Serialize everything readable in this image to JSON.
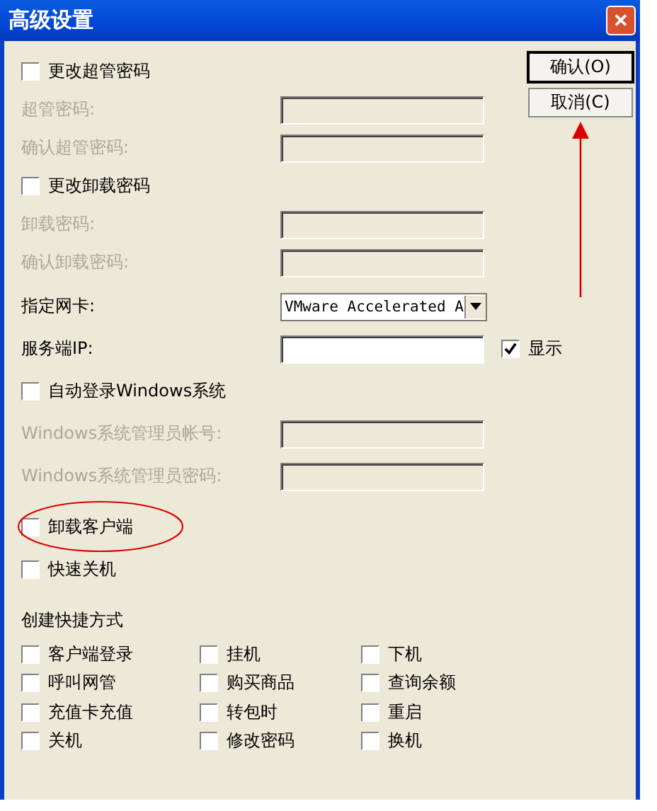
{
  "window": {
    "title": "高级设置",
    "close": "✕"
  },
  "buttons": [
    {
      "label": "确认(O)",
      "default": true
    },
    {
      "label": "取消(C)",
      "default": false
    }
  ],
  "top_rows": [
    {
      "kind": "checkbox",
      "label": "更改超管密码",
      "checked": false
    },
    {
      "kind": "field",
      "label": "超管密码:",
      "disabled": true
    },
    {
      "kind": "field",
      "label": "确认超管密码:",
      "disabled": true
    },
    {
      "kind": "checkbox",
      "label": "更改卸载密码",
      "checked": false
    },
    {
      "kind": "field",
      "label": "卸载密码:",
      "disabled": true
    },
    {
      "kind": "field",
      "label": "确认卸载密码:",
      "disabled": true
    }
  ],
  "rows": [
    {
      "kind": "select",
      "label": "指定网卡:",
      "value": "VMware Accelerated A"
    },
    {
      "kind": "field",
      "label": "服务端IP:",
      "disabled": false,
      "check": {
        "label": "显示",
        "checked": true
      }
    },
    {
      "kind": "checkbox",
      "label": "自动登录Windows系统",
      "checked": false
    },
    {
      "kind": "field",
      "label": "Windows系统管理员帐号:",
      "disabled": true
    },
    {
      "kind": "field",
      "label": "Windows系统管理员密码:",
      "disabled": true
    },
    {
      "kind": "checkbox",
      "label": "卸载客户端",
      "checked": false,
      "circled": true
    },
    {
      "kind": "checkbox",
      "label": "快速关机",
      "checked": false
    }
  ],
  "shortcuts": {
    "heading": "创建快捷方式",
    "items": [
      {
        "label": "客户端登录",
        "checked": false
      },
      {
        "label": "挂机",
        "checked": false
      },
      {
        "label": "下机",
        "checked": false
      },
      {
        "label": "呼叫网管",
        "checked": false
      },
      {
        "label": "购买商品",
        "checked": false
      },
      {
        "label": "查询余额",
        "checked": false
      },
      {
        "label": "充值卡充值",
        "checked": false
      },
      {
        "label": "转包时",
        "checked": false
      },
      {
        "label": "重启",
        "checked": false
      },
      {
        "label": "关机",
        "checked": false
      },
      {
        "label": "修改密码",
        "checked": false
      },
      {
        "label": "换机",
        "checked": false
      }
    ]
  },
  "annotation": {
    "arrow": true
  }
}
